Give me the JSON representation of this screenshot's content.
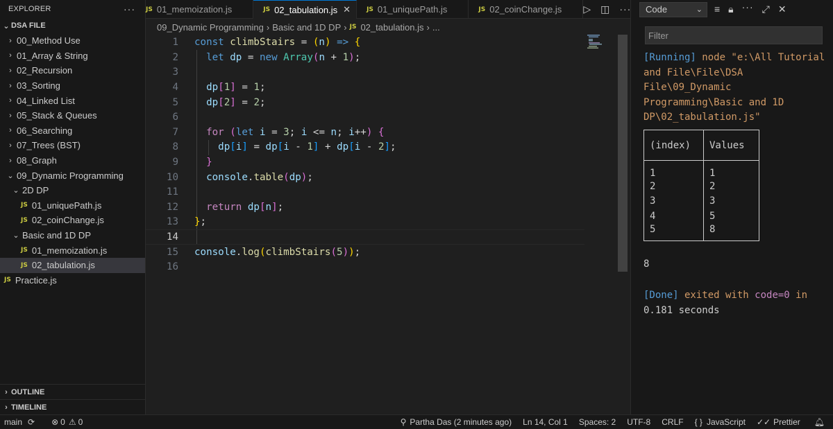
{
  "explorer": {
    "title": "EXPLORER",
    "root": "DSA FILE",
    "items": [
      {
        "label": "00_Method Use",
        "type": "folder",
        "open": false,
        "indent": 0
      },
      {
        "label": "01_Array & String",
        "type": "folder",
        "open": false,
        "indent": 0
      },
      {
        "label": "02_Recursion",
        "type": "folder",
        "open": false,
        "indent": 0
      },
      {
        "label": "03_Sorting",
        "type": "folder",
        "open": false,
        "indent": 0
      },
      {
        "label": "04_Linked List",
        "type": "folder",
        "open": false,
        "indent": 0
      },
      {
        "label": "05_Stack & Queues",
        "type": "folder",
        "open": false,
        "indent": 0
      },
      {
        "label": "06_Searching",
        "type": "folder",
        "open": false,
        "indent": 0
      },
      {
        "label": "07_Trees (BST)",
        "type": "folder",
        "open": false,
        "indent": 0
      },
      {
        "label": "08_Graph",
        "type": "folder",
        "open": false,
        "indent": 0
      },
      {
        "label": "09_Dynamic Programming",
        "type": "folder",
        "open": true,
        "indent": 0
      },
      {
        "label": "2D DP",
        "type": "folder",
        "open": true,
        "indent": 1
      },
      {
        "label": "01_uniquePath.js",
        "type": "file",
        "indent": 2
      },
      {
        "label": "02_coinChange.js",
        "type": "file",
        "indent": 2
      },
      {
        "label": "Basic and 1D DP",
        "type": "folder",
        "open": true,
        "indent": 1
      },
      {
        "label": "01_memoization.js",
        "type": "file",
        "indent": 2
      },
      {
        "label": "02_tabulation.js",
        "type": "file",
        "indent": 2,
        "selected": true
      },
      {
        "label": "Practice.js",
        "type": "file",
        "indent": 0
      }
    ],
    "outline": "OUTLINE",
    "timeline": "TIMELINE"
  },
  "tabs": [
    {
      "label": "01_memoization.js",
      "badge": "JS",
      "active": false
    },
    {
      "label": "02_tabulation.js",
      "badge": "JS",
      "active": true
    },
    {
      "label": "01_uniquePath.js",
      "badge": "JS",
      "active": false
    },
    {
      "label": "02_coinChange.js",
      "badge": "JS",
      "active": false
    }
  ],
  "breadcrumb": [
    "09_Dynamic Programming",
    "Basic and 1D DP",
    "02_tabulation.js",
    "..."
  ],
  "editor": {
    "current_line": 14,
    "lines": [
      [
        [
          "kw",
          "const"
        ],
        [
          "t",
          " "
        ],
        [
          "fn",
          "climbStairs"
        ],
        [
          "t",
          " "
        ],
        [
          "op",
          "="
        ],
        [
          "t",
          " "
        ],
        [
          "b1",
          "("
        ],
        [
          "var",
          "n"
        ],
        [
          "b1",
          ")"
        ],
        [
          "t",
          " "
        ],
        [
          "kw",
          "=>"
        ],
        [
          "t",
          " "
        ],
        [
          "b1",
          "{"
        ]
      ],
      [
        [
          "t",
          "  "
        ],
        [
          "kw",
          "let"
        ],
        [
          "t",
          " "
        ],
        [
          "var",
          "dp"
        ],
        [
          "t",
          " "
        ],
        [
          "op",
          "="
        ],
        [
          "t",
          " "
        ],
        [
          "kw",
          "new"
        ],
        [
          "t",
          " "
        ],
        [
          "cls",
          "Array"
        ],
        [
          "b2",
          "("
        ],
        [
          "var",
          "n"
        ],
        [
          "t",
          " "
        ],
        [
          "op",
          "+"
        ],
        [
          "t",
          " "
        ],
        [
          "num",
          "1"
        ],
        [
          "b2",
          ")"
        ],
        [
          "op",
          ";"
        ]
      ],
      [],
      [
        [
          "t",
          "  "
        ],
        [
          "var",
          "dp"
        ],
        [
          "b2",
          "["
        ],
        [
          "num",
          "1"
        ],
        [
          "b2",
          "]"
        ],
        [
          "t",
          " "
        ],
        [
          "op",
          "="
        ],
        [
          "t",
          " "
        ],
        [
          "num",
          "1"
        ],
        [
          "op",
          ";"
        ]
      ],
      [
        [
          "t",
          "  "
        ],
        [
          "var",
          "dp"
        ],
        [
          "b2",
          "["
        ],
        [
          "num",
          "2"
        ],
        [
          "b2",
          "]"
        ],
        [
          "t",
          " "
        ],
        [
          "op",
          "="
        ],
        [
          "t",
          " "
        ],
        [
          "num",
          "2"
        ],
        [
          "op",
          ";"
        ]
      ],
      [],
      [
        [
          "t",
          "  "
        ],
        [
          "ctl",
          "for"
        ],
        [
          "t",
          " "
        ],
        [
          "b2",
          "("
        ],
        [
          "kw",
          "let"
        ],
        [
          "t",
          " "
        ],
        [
          "var",
          "i"
        ],
        [
          "t",
          " "
        ],
        [
          "op",
          "="
        ],
        [
          "t",
          " "
        ],
        [
          "num",
          "3"
        ],
        [
          "op",
          ";"
        ],
        [
          "t",
          " "
        ],
        [
          "var",
          "i"
        ],
        [
          "t",
          " "
        ],
        [
          "op",
          "<="
        ],
        [
          "t",
          " "
        ],
        [
          "var",
          "n"
        ],
        [
          "op",
          ";"
        ],
        [
          "t",
          " "
        ],
        [
          "var",
          "i"
        ],
        [
          "op",
          "++"
        ],
        [
          "b2",
          ")"
        ],
        [
          "t",
          " "
        ],
        [
          "b2",
          "{"
        ]
      ],
      [
        [
          "t",
          "    "
        ],
        [
          "var",
          "dp"
        ],
        [
          "b3",
          "["
        ],
        [
          "var",
          "i"
        ],
        [
          "b3",
          "]"
        ],
        [
          "t",
          " "
        ],
        [
          "op",
          "="
        ],
        [
          "t",
          " "
        ],
        [
          "var",
          "dp"
        ],
        [
          "b3",
          "["
        ],
        [
          "var",
          "i"
        ],
        [
          "t",
          " "
        ],
        [
          "op",
          "-"
        ],
        [
          "t",
          " "
        ],
        [
          "num",
          "1"
        ],
        [
          "b3",
          "]"
        ],
        [
          "t",
          " "
        ],
        [
          "op",
          "+"
        ],
        [
          "t",
          " "
        ],
        [
          "var",
          "dp"
        ],
        [
          "b3",
          "["
        ],
        [
          "var",
          "i"
        ],
        [
          "t",
          " "
        ],
        [
          "op",
          "-"
        ],
        [
          "t",
          " "
        ],
        [
          "num",
          "2"
        ],
        [
          "b3",
          "]"
        ],
        [
          "op",
          ";"
        ]
      ],
      [
        [
          "t",
          "  "
        ],
        [
          "b2",
          "}"
        ]
      ],
      [
        [
          "t",
          "  "
        ],
        [
          "var",
          "console"
        ],
        [
          "op",
          "."
        ],
        [
          "fn",
          "table"
        ],
        [
          "b2",
          "("
        ],
        [
          "var",
          "dp"
        ],
        [
          "b2",
          ")"
        ],
        [
          "op",
          ";"
        ]
      ],
      [],
      [
        [
          "t",
          "  "
        ],
        [
          "ctl",
          "return"
        ],
        [
          "t",
          " "
        ],
        [
          "var",
          "dp"
        ],
        [
          "b2",
          "["
        ],
        [
          "var",
          "n"
        ],
        [
          "b2",
          "]"
        ],
        [
          "op",
          ";"
        ]
      ],
      [
        [
          "b1",
          "}"
        ],
        [
          "op",
          ";"
        ]
      ],
      [],
      [
        [
          "var",
          "console"
        ],
        [
          "op",
          "."
        ],
        [
          "fn",
          "log"
        ],
        [
          "b1",
          "("
        ],
        [
          "fn",
          "climbStairs"
        ],
        [
          "b2",
          "("
        ],
        [
          "num",
          "5"
        ],
        [
          "b2",
          ")"
        ],
        [
          "b1",
          ")"
        ],
        [
          "op",
          ";"
        ]
      ],
      []
    ]
  },
  "panel": {
    "select_value": "Code",
    "filter_placeholder": "Filter",
    "running_tag": "[Running]",
    "running_cmd": " node \"e:\\All Tutorial and File\\File\\DSA File\\09_Dynamic Programming\\Basic and 1D DP\\02_tabulation.js\"",
    "table_headers": [
      "(index)",
      "Values"
    ],
    "table_rows": [
      [
        "1",
        "1"
      ],
      [
        "2",
        "2"
      ],
      [
        "3",
        "3"
      ],
      [
        "4",
        "5"
      ],
      [
        "5",
        "8"
      ]
    ],
    "result": "8",
    "done_tag": "[Done]",
    "done_text": " exited with ",
    "done_code": "code=0",
    "done_in": " in",
    "done_time": "0.181 seconds"
  },
  "statusbar": {
    "branch": "main",
    "errors": "0",
    "warnings": "0",
    "author": "Partha Das (2 minutes ago)",
    "position": "Ln 14, Col 1",
    "spaces": "Spaces: 2",
    "encoding": "UTF-8",
    "eol": "CRLF",
    "language": "JavaScript",
    "formatter": "Prettier"
  }
}
